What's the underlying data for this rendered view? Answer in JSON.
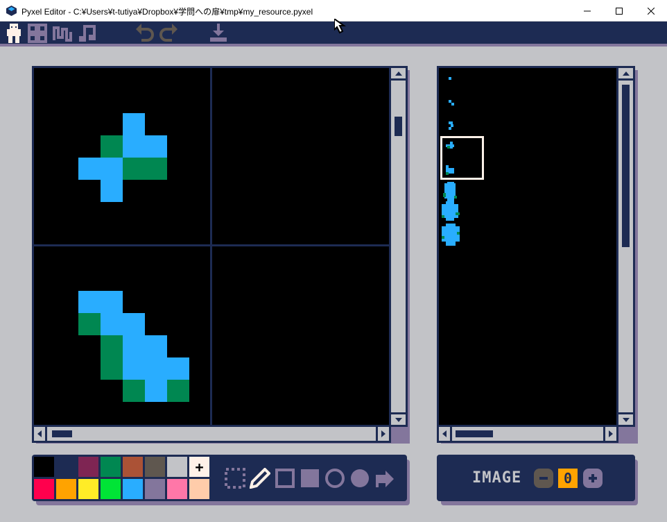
{
  "window": {
    "title": "Pyxel Editor - C:¥Users¥t-tutiya¥Dropbox¥学問への扉¥tmp¥my_resource.pyxel",
    "minimize_glyph": "—",
    "maximize_glyph": "☐",
    "close_glyph": "✕"
  },
  "toolbar": {
    "icons": [
      "image-editor-icon",
      "tilemap-editor-icon",
      "sound-editor-icon",
      "music-editor-icon",
      "undo-icon",
      "redo-icon",
      "save-icon"
    ]
  },
  "image_panel": {
    "label": "IMAGE",
    "number": "0",
    "decrement_glyph": "−",
    "increment_glyph": "+"
  },
  "palette": {
    "colors": [
      "#000000",
      "#1d2b53",
      "#7e2553",
      "#008751",
      "#ab5236",
      "#5f574f",
      "#c2c3c7",
      "#fff1e8",
      "#ff004d",
      "#ffa300",
      "#ffec27",
      "#00e436",
      "#29adff",
      "#83769c",
      "#ff77a8",
      "#ffccaa"
    ],
    "selected_index": 7,
    "selected_glyph": "+"
  },
  "tools": [
    "select-tool-icon",
    "pencil-tool-icon",
    "rectangle-outline-tool-icon",
    "rectangle-fill-tool-icon",
    "circle-outline-tool-icon",
    "circle-fill-tool-icon",
    "bucket-fill-tool-icon"
  ],
  "colors": {
    "navy": "#1d2b53",
    "gray": "#c2c3c7",
    "lavender": "#83769c",
    "sky": "#29adff",
    "green": "#008751"
  }
}
